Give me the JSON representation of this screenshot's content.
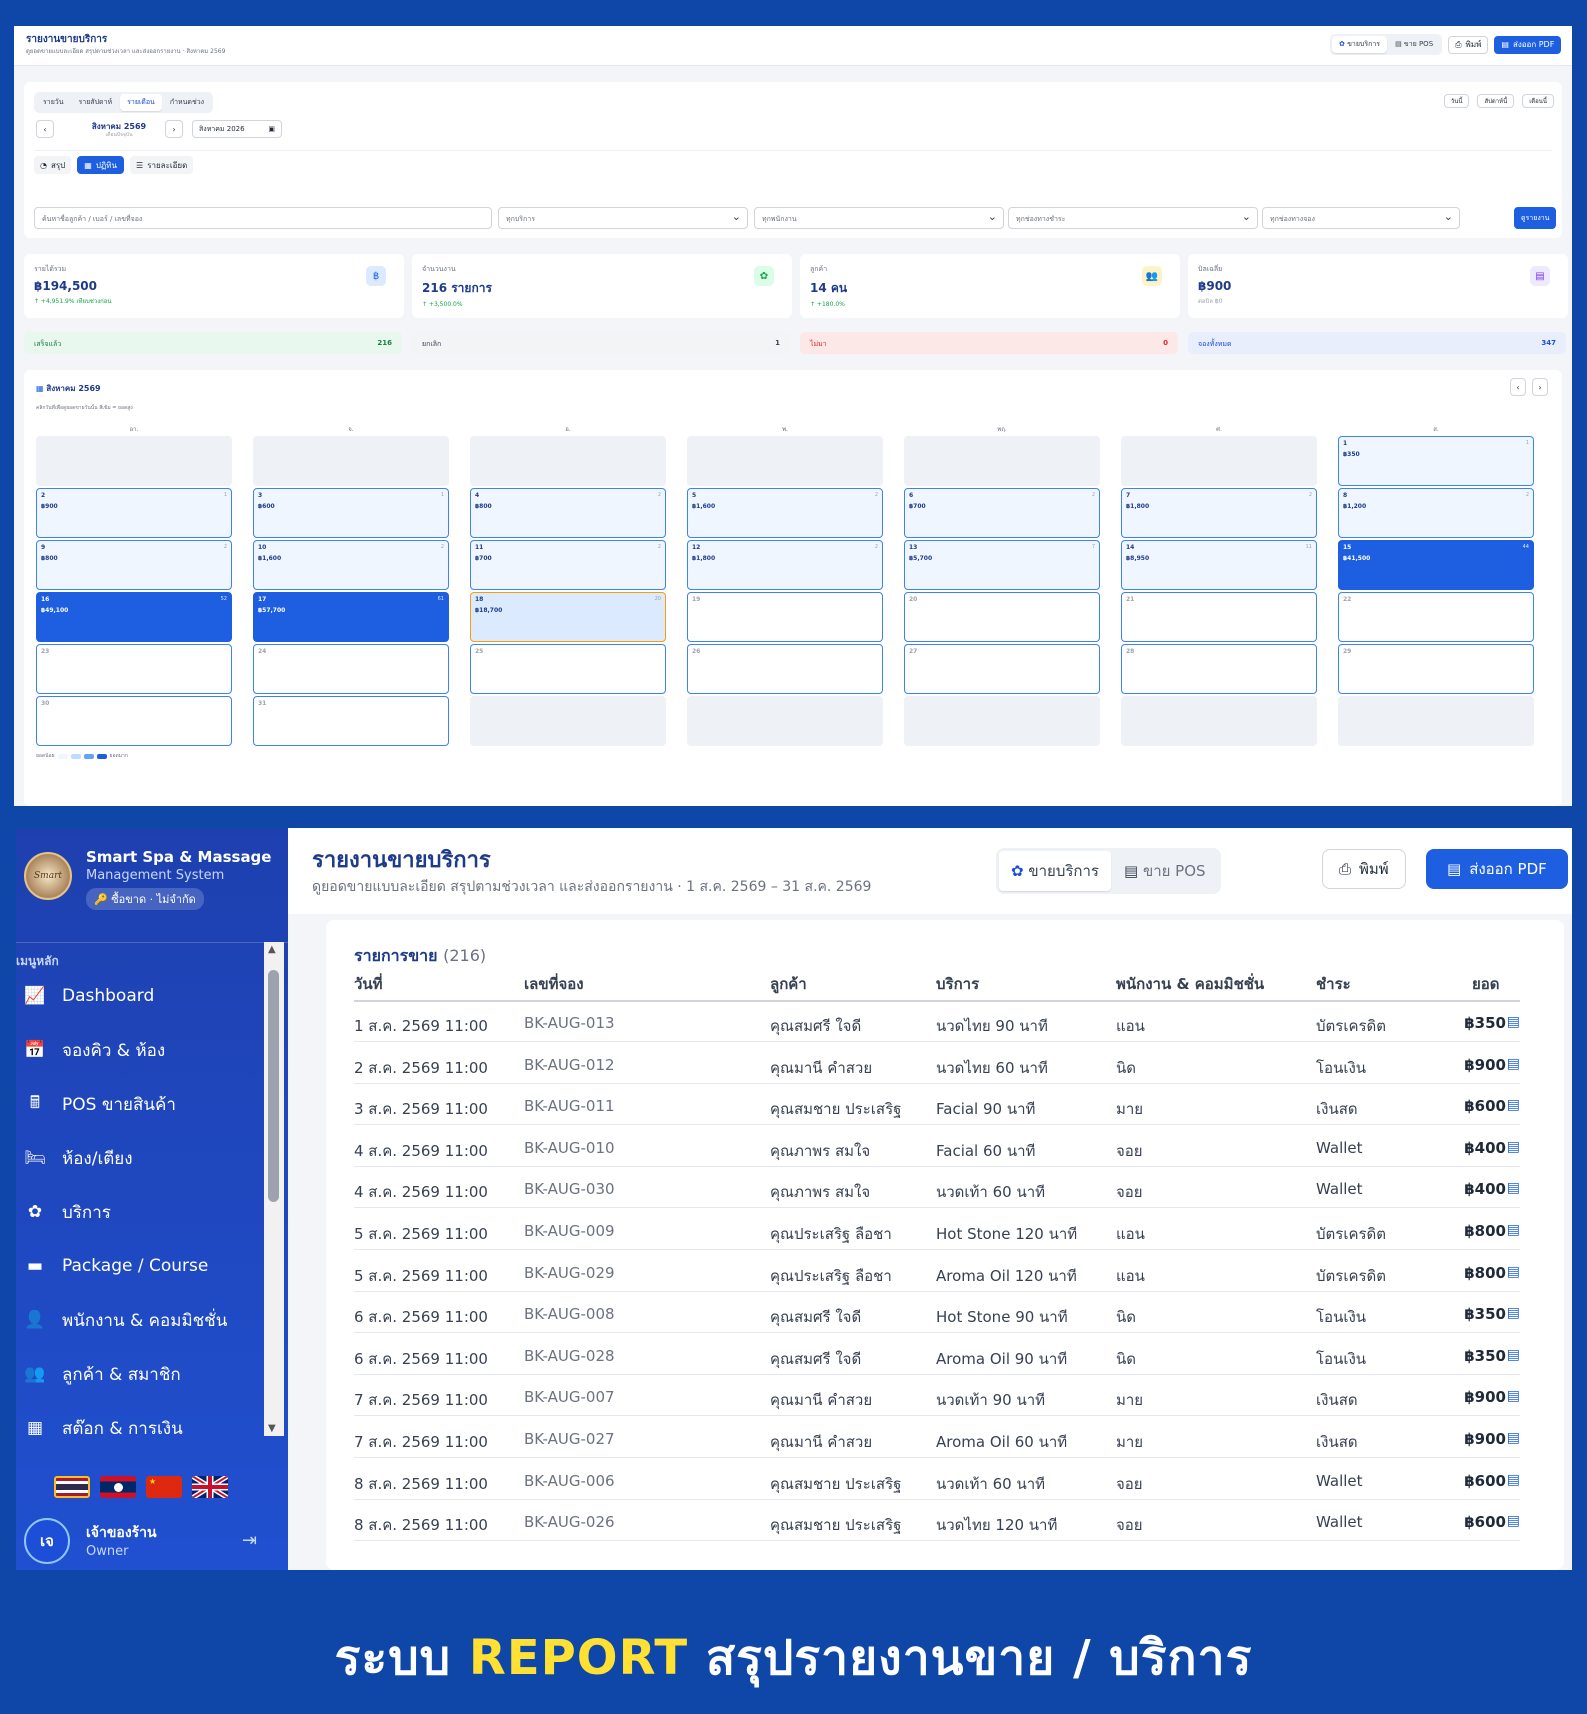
{
  "top": {
    "title": "รายงานขายบริการ",
    "subtitle": "ดูยอดขายแบบละเอียด สรุปตามช่วงเวลา และส่งออกรายงาน · สิงหาคม 2569",
    "mode_service": "ขายบริการ",
    "mode_pos": "ขาย POS",
    "print": "พิมพ์",
    "export_pdf": "ส่งออก PDF",
    "period_tabs": [
      "รายวัน",
      "รายสัปดาห์",
      "รายเดือน",
      "กำหนดช่วง"
    ],
    "active_period": "รายเดือน",
    "quick": [
      "วันนี้",
      "สัปดาห์นี้",
      "เดือนนี้"
    ],
    "month_label": "สิงหาคม 2569",
    "month_sub": "เดือนปัจจุบัน",
    "month_input": "สิงหาคม 2026",
    "view_tabs": {
      "summary": "สรุป",
      "calendar": "ปฏิทิน",
      "detail": "รายละเอียด"
    },
    "search_placeholder": "ค้นหาชื่อลูกค้า / เบอร์ / เลขที่จอง",
    "filters": [
      "ทุกบริการ",
      "ทุกพนักงาน",
      "ทุกช่องทางชำระ",
      "ทุกช่องทางจอง"
    ],
    "view_report": "ดูรายงาน",
    "stats": [
      {
        "label": "รายได้รวม",
        "value": "฿194,500",
        "sub": "↑ +4,951.9% เทียบช่วงก่อน",
        "icon": "฿",
        "color": "#2563eb",
        "bg": "#dbeafe"
      },
      {
        "label": "จำนวนงาน",
        "value": "216 รายการ",
        "sub": "↑ +3,500.0%",
        "icon": "✿",
        "color": "#16a34a",
        "bg": "#dcfce7"
      },
      {
        "label": "ลูกค้า",
        "value": "14 คน",
        "sub": "↑ +180.0%",
        "icon": "👥",
        "color": "#f59e0b",
        "bg": "#fef3c7"
      },
      {
        "label": "บิลเฉลี่ย",
        "value": "฿900",
        "sub": "ต่อบิล ฿0",
        "icon": "▤",
        "color": "#7c3aed",
        "bg": "#ede9fe"
      }
    ],
    "chips": [
      {
        "label": "เสร็จแล้ว",
        "count": "216",
        "bg": "#e8f8ee",
        "fg": "#15803d"
      },
      {
        "label": "ยกเลิก",
        "count": "1",
        "bg": "#f3f4f6",
        "fg": "#374151"
      },
      {
        "label": "ไม่มา",
        "count": "0",
        "bg": "#fde8e8",
        "fg": "#dc2626"
      },
      {
        "label": "จองทั้งหมด",
        "count": "347",
        "bg": "#e8eefb",
        "fg": "#1d4ed8"
      }
    ],
    "calendar_title": "สิงหาคม 2569",
    "calendar_hint": "คลิกวันที่เพื่อดูยอดขายวันนั้น สีเข้ม = ยอดสูง",
    "weekdays": [
      "อา.",
      "จ.",
      "อ.",
      "พ.",
      "พฤ.",
      "ศ.",
      "ส."
    ],
    "days": [
      {
        "d": "1",
        "amt": "฿350",
        "c": "1",
        "lvl": 1
      },
      {
        "d": "2",
        "amt": "฿900",
        "c": "1",
        "lvl": 1
      },
      {
        "d": "3",
        "amt": "฿600",
        "c": "1",
        "lvl": 1
      },
      {
        "d": "4",
        "amt": "฿800",
        "c": "2",
        "lvl": 1
      },
      {
        "d": "5",
        "amt": "฿1,600",
        "c": "2",
        "lvl": 1
      },
      {
        "d": "6",
        "amt": "฿700",
        "c": "2",
        "lvl": 1
      },
      {
        "d": "7",
        "amt": "฿1,800",
        "c": "2",
        "lvl": 1
      },
      {
        "d": "8",
        "amt": "฿1,200",
        "c": "2",
        "lvl": 1
      },
      {
        "d": "9",
        "amt": "฿800",
        "c": "2",
        "lvl": 1
      },
      {
        "d": "10",
        "amt": "฿1,600",
        "c": "2",
        "lvl": 1
      },
      {
        "d": "11",
        "amt": "฿700",
        "c": "2",
        "lvl": 1
      },
      {
        "d": "12",
        "amt": "฿1,800",
        "c": "2",
        "lvl": 1
      },
      {
        "d": "13",
        "amt": "฿5,700",
        "c": "7",
        "lvl": 1
      },
      {
        "d": "14",
        "amt": "฿8,950",
        "c": "11",
        "lvl": 1
      },
      {
        "d": "15",
        "amt": "฿41,500",
        "c": "44",
        "lvl": 3
      },
      {
        "d": "16",
        "amt": "฿49,100",
        "c": "52",
        "lvl": 3
      },
      {
        "d": "17",
        "amt": "฿57,700",
        "c": "61",
        "lvl": 3
      },
      {
        "d": "18",
        "amt": "฿18,700",
        "c": "20",
        "lvl": 2
      },
      {
        "d": "19",
        "amt": "",
        "c": "",
        "lvl": 0
      },
      {
        "d": "20",
        "amt": "",
        "c": "",
        "lvl": 0
      },
      {
        "d": "21",
        "amt": "",
        "c": "",
        "lvl": 0
      },
      {
        "d": "22",
        "amt": "",
        "c": "",
        "lvl": 0
      },
      {
        "d": "23",
        "amt": "",
        "c": "",
        "lvl": 0
      },
      {
        "d": "24",
        "amt": "",
        "c": "",
        "lvl": 0
      },
      {
        "d": "25",
        "amt": "",
        "c": "",
        "lvl": 0
      },
      {
        "d": "26",
        "amt": "",
        "c": "",
        "lvl": 0
      },
      {
        "d": "27",
        "amt": "",
        "c": "",
        "lvl": 0
      },
      {
        "d": "28",
        "amt": "",
        "c": "",
        "lvl": 0
      },
      {
        "d": "29",
        "amt": "",
        "c": "",
        "lvl": 0
      },
      {
        "d": "30",
        "amt": "",
        "c": "",
        "lvl": 0
      },
      {
        "d": "31",
        "amt": "",
        "c": "",
        "lvl": 0
      }
    ],
    "legend_low": "ยอดน้อย",
    "legend_high": "ยอดมาก"
  },
  "bottom": {
    "brand_title": "Smart Spa & Massage",
    "brand_sub": "Management System",
    "license": "ซื้อขาด · ไม่จำกัด",
    "menu_heading": "เมนูหลัก",
    "menu": [
      {
        "label": "Dashboard",
        "icon": "📈"
      },
      {
        "label": "จองคิว & ห้อง",
        "icon": "📅"
      },
      {
        "label": "POS ขายสินค้า",
        "icon": "🖩"
      },
      {
        "label": "ห้อง/เตียง",
        "icon": "🛏"
      },
      {
        "label": "บริการ",
        "icon": "✿"
      },
      {
        "label": "Package / Course",
        "icon": "▬"
      },
      {
        "label": "พนักงาน & คอมมิชชั่น",
        "icon": "👤"
      },
      {
        "label": "ลูกค้า & สมาชิก",
        "icon": "👥"
      },
      {
        "label": "สต๊อก & การเงิน",
        "icon": "▦"
      }
    ],
    "user_initial": "เจ",
    "user_name": "เจ้าของร้าน",
    "user_role": "Owner",
    "title": "รายงานขายบริการ",
    "subtitle": "ดูยอดขายแบบละเอียด สรุปตามช่วงเวลา และส่งออกรายงาน · 1 ส.ค. 2569 – 31 ส.ค. 2569",
    "mode_service": "ขายบริการ",
    "mode_pos": "ขาย POS",
    "print": "พิมพ์",
    "export_pdf": "ส่งออก PDF",
    "list_title": "รายการขาย",
    "list_count": "(216)",
    "columns": [
      "วันที่",
      "เลขที่จอง",
      "ลูกค้า",
      "บริการ",
      "พนักงาน & คอมมิชชั่น",
      "ชำระ",
      "ยอด"
    ],
    "rows": [
      [
        "1 ส.ค. 2569 11:00",
        "BK-AUG-013",
        "คุณสมศรี ใจดี",
        "นวดไทย 90 นาที",
        "แอน",
        "บัตรเครดิต",
        "฿350"
      ],
      [
        "2 ส.ค. 2569 11:00",
        "BK-AUG-012",
        "คุณมานี คำสวย",
        "นวดไทย 60 นาที",
        "นิด",
        "โอนเงิน",
        "฿900"
      ],
      [
        "3 ส.ค. 2569 11:00",
        "BK-AUG-011",
        "คุณสมชาย ประเสริฐ",
        "Facial 90 นาที",
        "มาย",
        "เงินสด",
        "฿600"
      ],
      [
        "4 ส.ค. 2569 11:00",
        "BK-AUG-010",
        "คุณภาพร สมใจ",
        "Facial 60 นาที",
        "จอย",
        "Wallet",
        "฿400"
      ],
      [
        "4 ส.ค. 2569 11:00",
        "BK-AUG-030",
        "คุณภาพร สมใจ",
        "นวดเท้า 60 นาที",
        "จอย",
        "Wallet",
        "฿400"
      ],
      [
        "5 ส.ค. 2569 11:00",
        "BK-AUG-009",
        "คุณประเสริฐ ลือชา",
        "Hot Stone 120 นาที",
        "แอน",
        "บัตรเครดิต",
        "฿800"
      ],
      [
        "5 ส.ค. 2569 11:00",
        "BK-AUG-029",
        "คุณประเสริฐ ลือชา",
        "Aroma Oil 120 นาที",
        "แอน",
        "บัตรเครดิต",
        "฿800"
      ],
      [
        "6 ส.ค. 2569 11:00",
        "BK-AUG-008",
        "คุณสมศรี ใจดี",
        "Hot Stone 90 นาที",
        "นิด",
        "โอนเงิน",
        "฿350"
      ],
      [
        "6 ส.ค. 2569 11:00",
        "BK-AUG-028",
        "คุณสมศรี ใจดี",
        "Aroma Oil 90 นาที",
        "นิด",
        "โอนเงิน",
        "฿350"
      ],
      [
        "7 ส.ค. 2569 11:00",
        "BK-AUG-007",
        "คุณมานี คำสวย",
        "นวดเท้า 90 นาที",
        "มาย",
        "เงินสด",
        "฿900"
      ],
      [
        "7 ส.ค. 2569 11:00",
        "BK-AUG-027",
        "คุณมานี คำสวย",
        "Aroma Oil 60 นาที",
        "มาย",
        "เงินสด",
        "฿900"
      ],
      [
        "8 ส.ค. 2569 11:00",
        "BK-AUG-006",
        "คุณสมชาย ประเสริฐ",
        "นวดเท้า 60 นาที",
        "จอย",
        "Wallet",
        "฿600"
      ],
      [
        "8 ส.ค. 2569 11:00",
        "BK-AUG-026",
        "คุณสมชาย ประเสริฐ",
        "นวดไทย 120 นาที",
        "จอย",
        "Wallet",
        "฿600"
      ]
    ]
  },
  "caption": {
    "pre": "ระบบ ",
    "highlight": "REPORT",
    "post": " สรุปรายงานขาย / บริการ"
  }
}
